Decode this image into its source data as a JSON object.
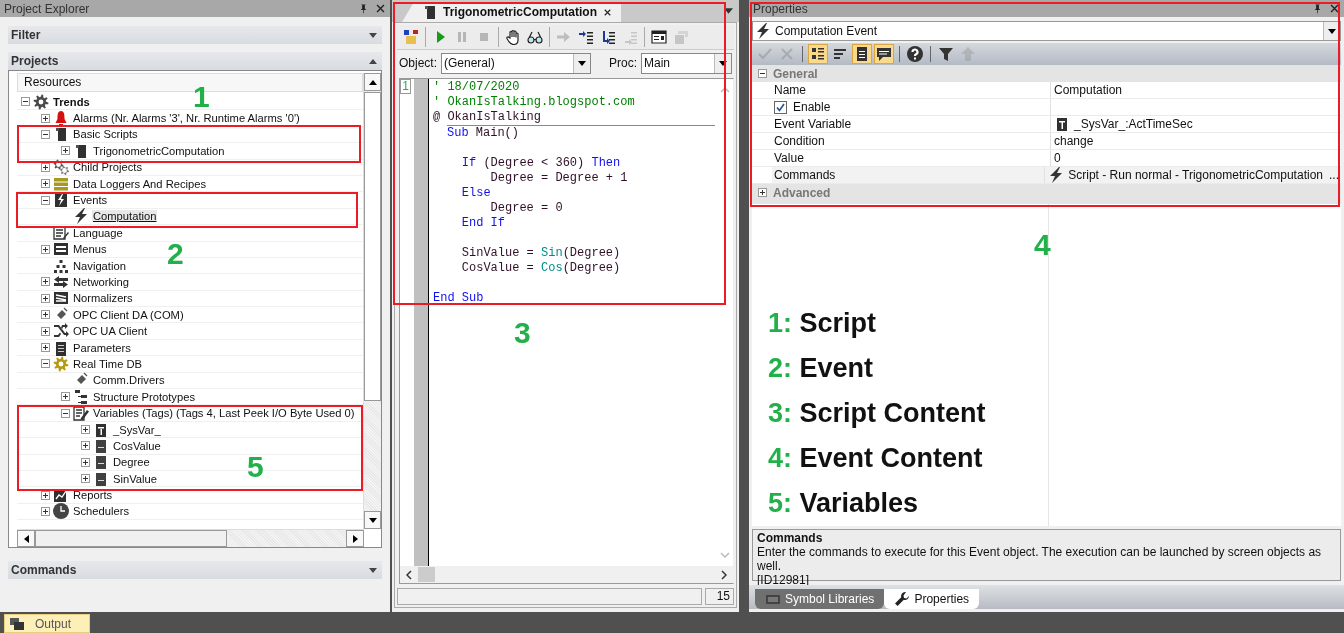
{
  "project_explorer": {
    "title": "Project Explorer",
    "filter": {
      "label": "Filter",
      "expanded": false
    },
    "projects": {
      "label": "Projects",
      "expanded": true
    },
    "column_header": "Resources",
    "tree": [
      {
        "label": "Trends",
        "kind": "project",
        "expanded": true,
        "selected": false,
        "children": [
          {
            "label": "Alarms (Nr. Alarms '3', Nr. Runtime Alarms '0')",
            "kind": "alarm",
            "expanded": false,
            "selected": false
          },
          {
            "label": "Basic Scripts",
            "kind": "script",
            "expanded": true,
            "selected": false,
            "children": [
              {
                "label": "TrigonometricComputation",
                "kind": "script",
                "expanded": false,
                "selected": false
              }
            ]
          },
          {
            "label": "Child Projects",
            "kind": "gears",
            "expanded": false,
            "selected": false
          },
          {
            "label": "Data Loggers And Recipes",
            "kind": "logger",
            "expanded": false,
            "selected": false
          },
          {
            "label": "Events",
            "kind": "events",
            "expanded": true,
            "selected": false,
            "children": [
              {
                "label": "Computation",
                "kind": "event",
                "selected": true
              }
            ]
          },
          {
            "label": "Language",
            "kind": "language",
            "selected": false
          },
          {
            "label": "Menus",
            "kind": "menu",
            "expanded": false,
            "selected": false
          },
          {
            "label": "Navigation",
            "kind": "navigation",
            "selected": false
          },
          {
            "label": "Networking",
            "kind": "network",
            "expanded": false,
            "selected": false
          },
          {
            "label": "Normalizers",
            "kind": "normalizer",
            "expanded": false,
            "selected": false
          },
          {
            "label": "OPC Client DA (COM)",
            "kind": "plug",
            "expanded": false,
            "selected": false
          },
          {
            "label": "OPC UA Client",
            "kind": "shuffle",
            "expanded": false,
            "selected": false
          },
          {
            "label": "Parameters",
            "kind": "parameters",
            "expanded": false,
            "selected": false
          },
          {
            "label": "Real Time DB",
            "kind": "database",
            "expanded": true,
            "selected": false,
            "children": [
              {
                "label": "Comm.Drivers",
                "kind": "plug",
                "selected": false
              },
              {
                "label": "Structure Prototypes",
                "kind": "structure",
                "expanded": false,
                "selected": false
              },
              {
                "label": "Variables (Tags) (Tags 4, Last Peek I/O Byte Used 0)",
                "kind": "variables",
                "expanded": true,
                "selected": false,
                "children": [
                  {
                    "label": "_SysVar_",
                    "kind": "tag-group",
                    "expanded": false,
                    "selected": false
                  },
                  {
                    "label": "CosValue",
                    "kind": "tag",
                    "expanded": false,
                    "selected": false
                  },
                  {
                    "label": "Degree",
                    "kind": "tag",
                    "expanded": false,
                    "selected": false
                  },
                  {
                    "label": "SinValue",
                    "kind": "tag",
                    "expanded": false,
                    "selected": false
                  }
                ]
              }
            ]
          },
          {
            "label": "Reports",
            "kind": "report",
            "expanded": false,
            "selected": false
          },
          {
            "label": "Schedulers",
            "kind": "clock",
            "expanded": false,
            "selected": false
          }
        ]
      }
    ],
    "commands": {
      "label": "Commands",
      "expanded": false
    }
  },
  "editor": {
    "tab": "TrigonometricComputation",
    "toolbar": [
      {
        "kind": "properties",
        "disabled": false
      },
      {
        "kind": "separator"
      },
      {
        "kind": "run",
        "disabled": false
      },
      {
        "kind": "pause",
        "disabled": true
      },
      {
        "kind": "stop",
        "disabled": true
      },
      {
        "kind": "separator"
      },
      {
        "kind": "hand",
        "disabled": false
      },
      {
        "kind": "glasses",
        "disabled": false
      },
      {
        "kind": "separator"
      },
      {
        "kind": "step",
        "disabled": true
      },
      {
        "kind": "step-into",
        "disabled": false
      },
      {
        "kind": "step-over",
        "disabled": false
      },
      {
        "kind": "step-out",
        "disabled": true
      },
      {
        "kind": "separator"
      },
      {
        "kind": "window",
        "disabled": false
      },
      {
        "kind": "box",
        "disabled": true
      }
    ],
    "object_label": "Object:",
    "object_value": "(General)",
    "proc_label": "Proc:",
    "proc_value": "Main",
    "line_number": "1",
    "lines": [
      {
        "kind": "code",
        "tokens": [
          {
            "t": "' 18/07/2020",
            "kind": "comment"
          }
        ]
      },
      {
        "kind": "code",
        "tokens": [
          {
            "t": "' OkanIsTalking.blogspot.com",
            "kind": "comment"
          }
        ]
      },
      {
        "kind": "code",
        "tokens": [
          {
            "t": "@ OkanIsTalking",
            "kind": "text"
          }
        ]
      },
      {
        "kind": "procedure",
        "tokens": [
          {
            "t": "Sub",
            "kind": "keyword"
          },
          {
            "t": " Main()",
            "kind": "text"
          }
        ]
      },
      {
        "kind": "blank"
      },
      {
        "kind": "code",
        "tokens": [
          {
            "t": "    If",
            "kind": "keyword"
          },
          {
            "t": " (Degree < 360) ",
            "kind": "text"
          },
          {
            "t": "Then",
            "kind": "keyword"
          }
        ]
      },
      {
        "kind": "code",
        "tokens": [
          {
            "t": "        Degree = Degree + 1",
            "kind": "text"
          }
        ]
      },
      {
        "kind": "code",
        "tokens": [
          {
            "t": "    Else",
            "kind": "keyword"
          }
        ]
      },
      {
        "kind": "code",
        "tokens": [
          {
            "t": "        Degree = 0",
            "kind": "text"
          }
        ]
      },
      {
        "kind": "code",
        "tokens": [
          {
            "t": "    End If",
            "kind": "keyword"
          }
        ]
      },
      {
        "kind": "blank"
      },
      {
        "kind": "code",
        "tokens": [
          {
            "t": "    SinValue = ",
            "kind": "text"
          },
          {
            "t": "Sin",
            "kind": "function"
          },
          {
            "t": "(Degree)",
            "kind": "text"
          }
        ]
      },
      {
        "kind": "code",
        "tokens": [
          {
            "t": "    CosValue = ",
            "kind": "text"
          },
          {
            "t": "Cos",
            "kind": "function"
          },
          {
            "t": "(Degree)",
            "kind": "text"
          }
        ]
      },
      {
        "kind": "blank"
      },
      {
        "kind": "code",
        "tokens": [
          {
            "t": "End Sub",
            "kind": "keyword"
          }
        ]
      }
    ],
    "status": "15"
  },
  "properties": {
    "title": "Properties",
    "object": "Computation Event",
    "toolbar": [
      {
        "kind": "check",
        "disabled": true,
        "on": false
      },
      {
        "kind": "cross",
        "disabled": true,
        "on": false
      },
      {
        "kind": "separator"
      },
      {
        "kind": "categorized",
        "disabled": false,
        "on": true
      },
      {
        "kind": "alphabetical",
        "disabled": false,
        "on": false
      },
      {
        "kind": "description",
        "disabled": false,
        "on": true
      },
      {
        "kind": "comment",
        "disabled": false,
        "on": true
      },
      {
        "kind": "separator"
      },
      {
        "kind": "help",
        "disabled": false,
        "on": false
      },
      {
        "kind": "separator"
      },
      {
        "kind": "filter",
        "disabled": false,
        "on": false
      },
      {
        "kind": "up",
        "disabled": true,
        "on": false
      }
    ],
    "categories": [
      {
        "label": "General",
        "expanded": true,
        "rows": [
          {
            "name": "Name",
            "kind": "text",
            "value": "Computation"
          },
          {
            "name": "Enable",
            "kind": "checkbox",
            "checked": true
          },
          {
            "name": "Event Variable",
            "kind": "variable",
            "value": "_SysVar_:ActTimeSec"
          },
          {
            "name": "Condition",
            "kind": "text",
            "value": "change"
          },
          {
            "name": "Value",
            "kind": "text",
            "value": "0"
          },
          {
            "name": "Commands",
            "kind": "command",
            "value": "Script - Run normal - TrigonometricComputation",
            "button": "..."
          }
        ]
      },
      {
        "label": "Advanced",
        "expanded": false
      }
    ],
    "help_title": "Commands",
    "help_text": "Enter the commands to execute for this Event object. The execution can be launched by screen objects as well.",
    "help_id": "[ID12981]",
    "tabs": [
      {
        "label": "Symbol Libraries",
        "kind": "library",
        "selected": false
      },
      {
        "label": "Properties",
        "kind": "wrench",
        "selected": true
      }
    ]
  },
  "annotations": [
    {
      "label": "1"
    },
    {
      "label": "2"
    },
    {
      "label": "3"
    },
    {
      "label": "4"
    },
    {
      "label": "5"
    }
  ],
  "legend": [
    {
      "number": "1:",
      "text": "Script"
    },
    {
      "number": "2:",
      "text": "Event"
    },
    {
      "number": "3:",
      "text": "Script Content"
    },
    {
      "number": "4:",
      "text": "Event Content"
    },
    {
      "number": "5:",
      "text": "Variables"
    }
  ],
  "output_tab": "Output"
}
